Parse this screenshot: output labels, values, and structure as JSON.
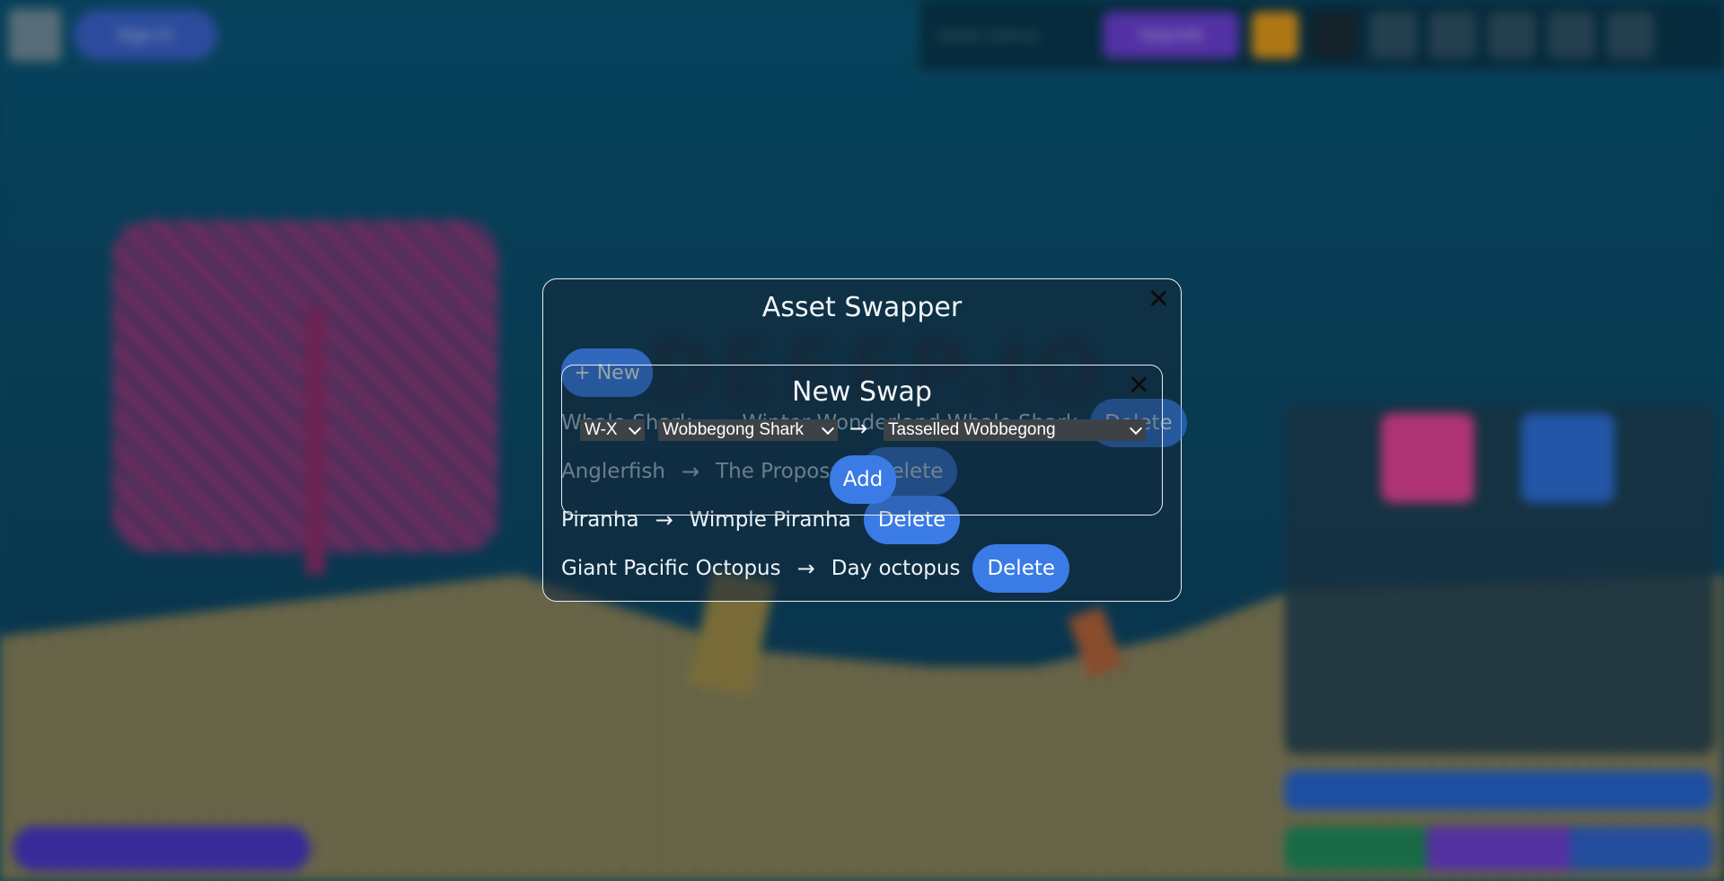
{
  "background": {
    "sign_in_label": "Sign In",
    "upgrade_label": "Upgrade",
    "top_text": "Diepio Games",
    "show_label": "Show in game"
  },
  "asset_swapper": {
    "title": "Asset Swapper",
    "new_button": "+ New",
    "swaps": [
      {
        "from": "Whale Shark",
        "to": "Winter Wonderland Whale Shark",
        "delete": "Delete"
      },
      {
        "from": "Anglerfish",
        "to": "The Proposal",
        "delete": "Delete"
      },
      {
        "from": "Piranha",
        "to": "Wimple Piranha",
        "delete": "Delete"
      },
      {
        "from": "Giant Pacific Octopus",
        "to": "Day octopus",
        "delete": "Delete"
      }
    ],
    "arrow": "→"
  },
  "new_swap": {
    "title": "New Swap",
    "group_select": "W-X",
    "animal_select": "Wobbegong Shark",
    "skin_select": "Tasselled Wobbegong",
    "arrow": "→",
    "add_button": "Add"
  },
  "colors": {
    "accent": "#3a7be6",
    "modal_border": "#e6eef4"
  }
}
